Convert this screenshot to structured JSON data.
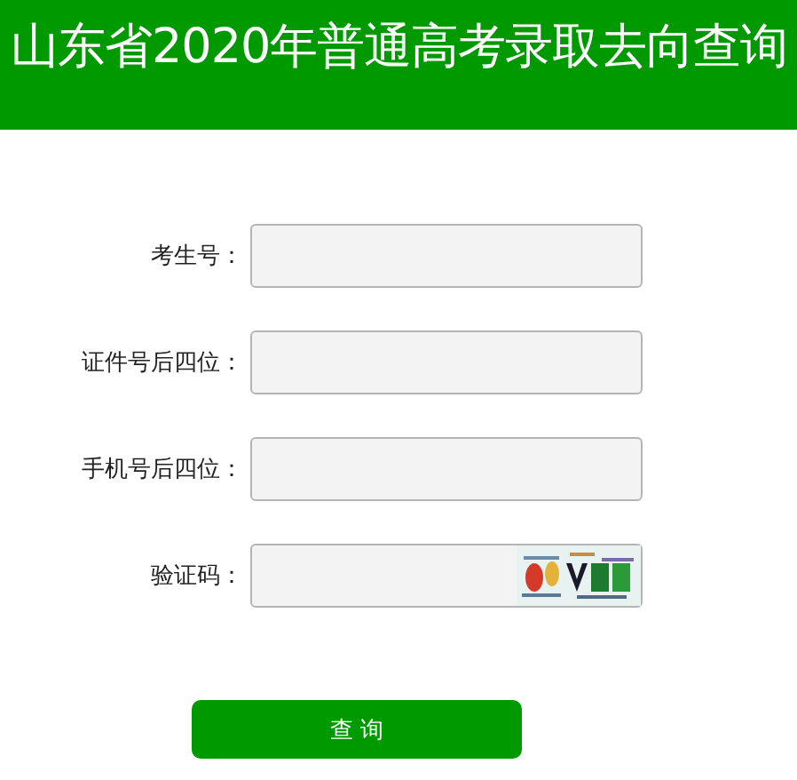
{
  "header": {
    "title": "山东省2020年普通高考录取去向查询"
  },
  "form": {
    "fields": [
      {
        "label": "考生号：",
        "kind": "text"
      },
      {
        "label": "证件号后四位：",
        "kind": "text"
      },
      {
        "label": "手机号后四位：",
        "kind": "text"
      },
      {
        "label": "验证码：",
        "kind": "captcha"
      }
    ],
    "submit": "查 询"
  }
}
